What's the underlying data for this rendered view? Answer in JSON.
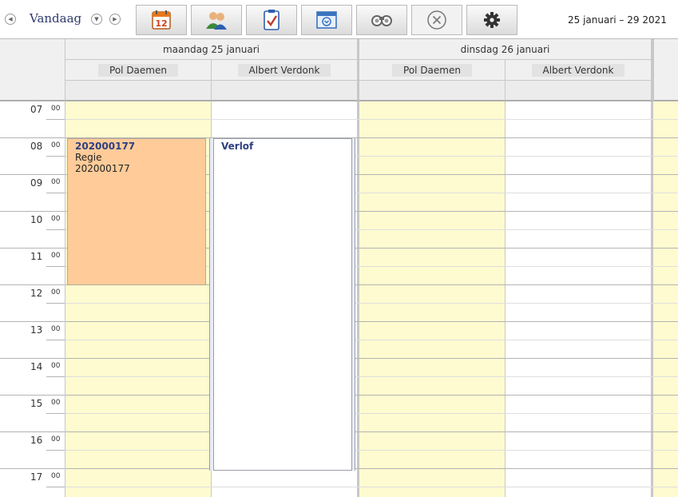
{
  "toolbar": {
    "prev_icon": "chevron-left-icon",
    "today_label": "Vandaag",
    "next_icon": "chevron-right-icon",
    "buttons": [
      {
        "icon": "calendar-day-icon",
        "badge": "12"
      },
      {
        "icon": "users-icon"
      },
      {
        "icon": "checklist-icon"
      },
      {
        "icon": "calendar-week-icon"
      },
      {
        "icon": "binoculars-icon"
      },
      {
        "icon": "close-circle-icon"
      },
      {
        "icon": "gear-icon"
      }
    ],
    "date_range": "25 januari – 29 2021"
  },
  "days": [
    {
      "label": "maandag 25 januari",
      "persons": [
        "Pol Daemen",
        "Albert Verdonk"
      ]
    },
    {
      "label": "dinsdag 26 januari",
      "persons": [
        "Pol Daemen",
        "Albert Verdonk"
      ]
    }
  ],
  "hours": [
    {
      "h": "07",
      "m": "00"
    },
    {
      "h": "08",
      "m": "00"
    },
    {
      "h": "09",
      "m": "00"
    },
    {
      "h": "10",
      "m": "00"
    },
    {
      "h": "11",
      "m": "00"
    },
    {
      "h": "12",
      "m": "00"
    },
    {
      "h": "13",
      "m": "00"
    },
    {
      "h": "14",
      "m": "00"
    },
    {
      "h": "15",
      "m": "00"
    },
    {
      "h": "16",
      "m": "00"
    },
    {
      "h": "17",
      "m": "00"
    }
  ],
  "events": [
    {
      "title": "202000177",
      "lines": [
        "Regie",
        "202000177"
      ],
      "color": "#ffcc99"
    },
    {
      "title": "Verlof",
      "lines": [],
      "color": "#ffffff"
    }
  ],
  "colors": {
    "free_slot": "#fefbd0",
    "accent": "#2e4080"
  }
}
